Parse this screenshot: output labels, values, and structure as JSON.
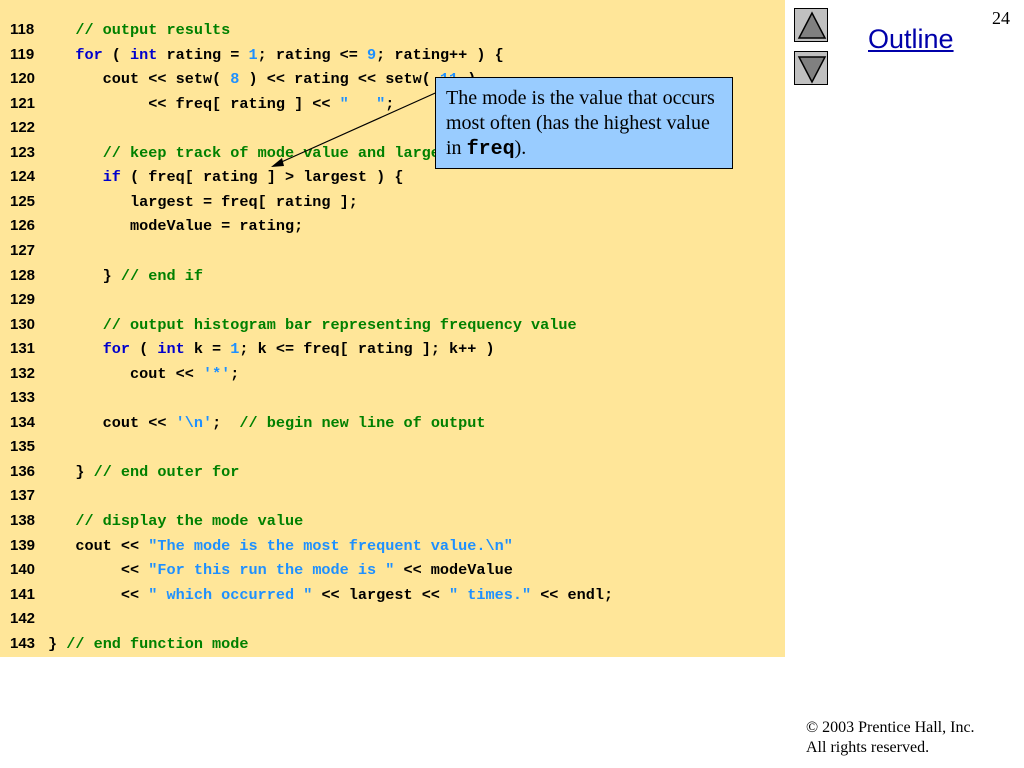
{
  "slide": {
    "page_number": "24",
    "outline_label": "Outline",
    "footer_line1": "© 2003 Prentice Hall, Inc.",
    "footer_line2": "All rights reserved."
  },
  "callout": {
    "text_before": "The mode is the value that occurs most often (has the highest value in ",
    "code_word": "freq",
    "text_after": ")."
  },
  "code_lines": [
    {
      "n": "118",
      "segs": [
        [
          "p",
          "   "
        ],
        [
          "c",
          "// output results"
        ]
      ]
    },
    {
      "n": "119",
      "segs": [
        [
          "p",
          "   "
        ],
        [
          "k",
          "for"
        ],
        [
          "p",
          " ( "
        ],
        [
          "k",
          "int"
        ],
        [
          "p",
          " rating = "
        ],
        [
          "n",
          "1"
        ],
        [
          "p",
          "; rating <= "
        ],
        [
          "n",
          "9"
        ],
        [
          "p",
          "; rating++ ) {"
        ]
      ]
    },
    {
      "n": "120",
      "segs": [
        [
          "p",
          "      cout << setw( "
        ],
        [
          "n",
          "8"
        ],
        [
          "p",
          " ) << rating << setw( "
        ],
        [
          "n",
          "11"
        ],
        [
          "p",
          " )"
        ]
      ]
    },
    {
      "n": "121",
      "segs": [
        [
          "p",
          "           << freq[ rating ] << "
        ],
        [
          "s",
          "\"   \""
        ],
        [
          "p",
          ";"
        ]
      ]
    },
    {
      "n": "122",
      "segs": []
    },
    {
      "n": "123",
      "segs": [
        [
          "p",
          "      "
        ],
        [
          "c",
          "// keep track of mode value and largest frequency value"
        ]
      ]
    },
    {
      "n": "124",
      "segs": [
        [
          "p",
          "      "
        ],
        [
          "k",
          "if"
        ],
        [
          "p",
          " ( freq[ rating ] > largest ) {"
        ]
      ]
    },
    {
      "n": "125",
      "segs": [
        [
          "p",
          "         largest = freq[ rating ];"
        ]
      ]
    },
    {
      "n": "126",
      "segs": [
        [
          "p",
          "         modeValue = rating;"
        ]
      ]
    },
    {
      "n": "127",
      "segs": []
    },
    {
      "n": "128",
      "segs": [
        [
          "p",
          "      } "
        ],
        [
          "c",
          "// end if"
        ]
      ]
    },
    {
      "n": "129",
      "segs": []
    },
    {
      "n": "130",
      "segs": [
        [
          "p",
          "      "
        ],
        [
          "c",
          "// output histogram bar representing frequency value"
        ]
      ]
    },
    {
      "n": "131",
      "segs": [
        [
          "p",
          "      "
        ],
        [
          "k",
          "for"
        ],
        [
          "p",
          " ( "
        ],
        [
          "k",
          "int"
        ],
        [
          "p",
          " k = "
        ],
        [
          "n",
          "1"
        ],
        [
          "p",
          "; k <= freq[ rating ]; k++ )"
        ]
      ]
    },
    {
      "n": "132",
      "segs": [
        [
          "p",
          "         cout << "
        ],
        [
          "s",
          "'*'"
        ],
        [
          "p",
          ";"
        ]
      ]
    },
    {
      "n": "133",
      "segs": []
    },
    {
      "n": "134",
      "segs": [
        [
          "p",
          "      cout << "
        ],
        [
          "s",
          "'\\n'"
        ],
        [
          "p",
          ";  "
        ],
        [
          "c",
          "// begin new line of output"
        ]
      ]
    },
    {
      "n": "135",
      "segs": []
    },
    {
      "n": "136",
      "segs": [
        [
          "p",
          "   } "
        ],
        [
          "c",
          "// end outer for"
        ]
      ]
    },
    {
      "n": "137",
      "segs": []
    },
    {
      "n": "138",
      "segs": [
        [
          "p",
          "   "
        ],
        [
          "c",
          "// display the mode value"
        ]
      ]
    },
    {
      "n": "139",
      "segs": [
        [
          "p",
          "   cout << "
        ],
        [
          "s",
          "\"The mode is the most frequent value.\\n\""
        ]
      ]
    },
    {
      "n": "140",
      "segs": [
        [
          "p",
          "        << "
        ],
        [
          "s",
          "\"For this run the mode is \""
        ],
        [
          "p",
          " << modeValue"
        ]
      ]
    },
    {
      "n": "141",
      "segs": [
        [
          "p",
          "        << "
        ],
        [
          "s",
          "\" which occurred \""
        ],
        [
          "p",
          " << largest << "
        ],
        [
          "s",
          "\" times.\""
        ],
        [
          "p",
          " << endl;"
        ]
      ]
    },
    {
      "n": "142",
      "segs": []
    },
    {
      "n": "143",
      "segs": [
        [
          "p",
          "} "
        ],
        [
          "c",
          "// end function mode"
        ]
      ]
    }
  ]
}
